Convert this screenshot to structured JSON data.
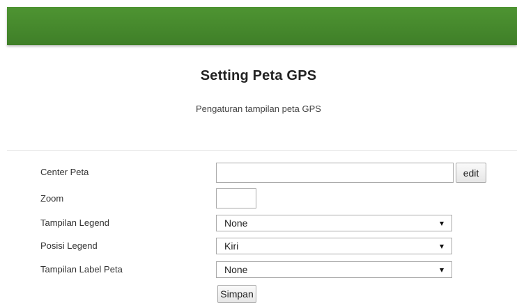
{
  "header": {
    "title": "Setting Peta GPS",
    "subtitle": "Pengaturan tampilan peta GPS"
  },
  "form": {
    "center": {
      "label": "Center Peta",
      "value": "",
      "button_label": "edit"
    },
    "zoom": {
      "label": "Zoom",
      "value": ""
    },
    "legend_display": {
      "label": "Tampilan Legend",
      "selected": "None"
    },
    "legend_position": {
      "label": "Posisi Legend",
      "selected": "Kiri"
    },
    "map_label_display": {
      "label": "Tampilan Label Peta",
      "selected": "None"
    },
    "save_label": "Simpan"
  },
  "colors": {
    "topbar": "#4e9432",
    "divider": "#ececec"
  }
}
